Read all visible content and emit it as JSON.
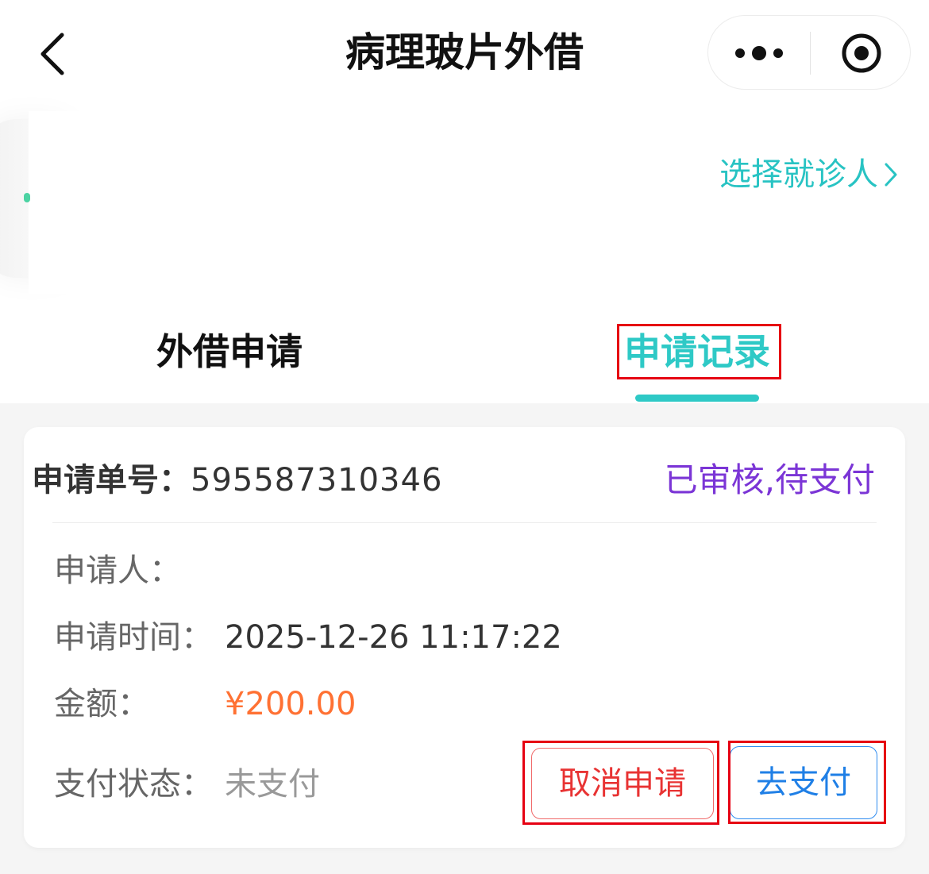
{
  "nav": {
    "title": "病理玻片外借",
    "back_icon": "chevron-left-icon",
    "more_icon": "more-dots-icon",
    "close_icon": "target-close-icon"
  },
  "patient": {
    "select_label": "选择就诊人",
    "arrow_icon": "chevron-right-icon"
  },
  "tabs": [
    {
      "label": "外借申请",
      "active": false
    },
    {
      "label": "申请记录",
      "active": true
    }
  ],
  "record": {
    "order_label": "申请单号：",
    "order_no": "595587310346",
    "status": "已审核,待支付",
    "applicant_label": "申请人：",
    "applicant_value": "",
    "time_label": "申请时间：",
    "time_value": "2025-12-26 11:17:22",
    "amount_label": "金额：",
    "amount_value": "¥200.00",
    "pay_status_label": "支付状态：",
    "pay_status_value": "未支付",
    "cancel_button": "取消申请",
    "pay_button": "去支付"
  },
  "colors": {
    "accent": "#2ec9c6",
    "status": "#7b35d6",
    "amount": "#ff7133",
    "cancel": "#e83333",
    "pay": "#1f7fe6",
    "annotation": "#e60012"
  }
}
